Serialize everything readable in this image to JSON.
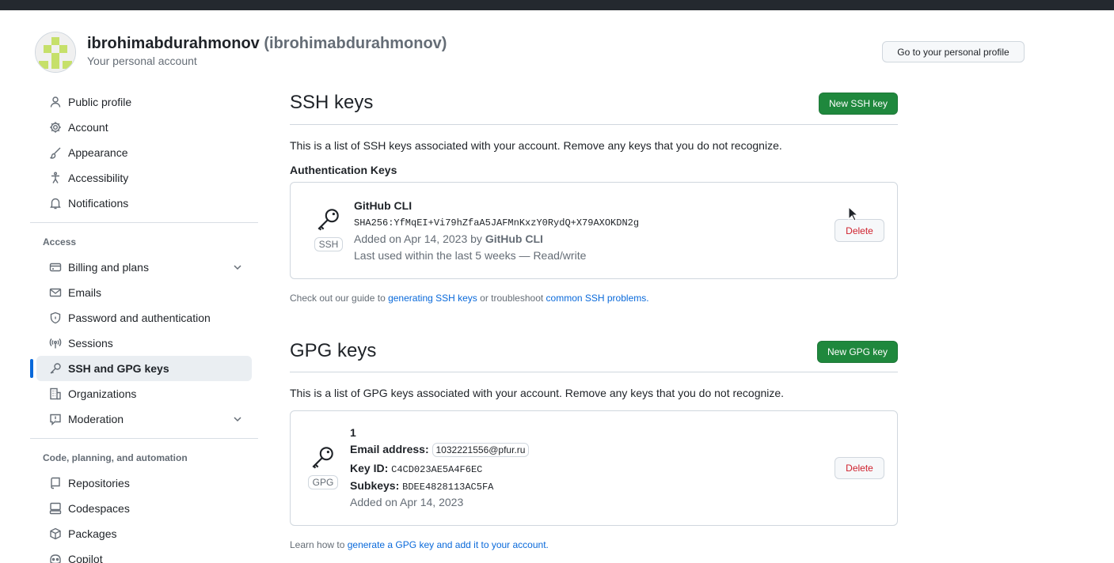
{
  "header": {
    "user_name": "ibrohimabdurahmonov",
    "user_login": "(ibrohimabdurahmonov)",
    "subtitle": "Your personal account",
    "profile_button": "Go to your personal profile",
    "avatar_color": "#c6e06a"
  },
  "sidebar": {
    "items_top": [
      {
        "label": "Public profile",
        "icon": "person-icon"
      },
      {
        "label": "Account",
        "icon": "gear-icon"
      },
      {
        "label": "Appearance",
        "icon": "paintbrush-icon"
      },
      {
        "label": "Accessibility",
        "icon": "accessibility-icon"
      },
      {
        "label": "Notifications",
        "icon": "bell-icon"
      }
    ],
    "access_heading": "Access",
    "items_access": [
      {
        "label": "Billing and plans",
        "icon": "credit-card-icon"
      },
      {
        "label": "Emails",
        "icon": "mail-icon"
      },
      {
        "label": "Password and authentication",
        "icon": "shield-lock-icon"
      },
      {
        "label": "Sessions",
        "icon": "broadcast-icon"
      },
      {
        "label": "SSH and GPG keys",
        "icon": "key-icon"
      },
      {
        "label": "Organizations",
        "icon": "organization-icon"
      },
      {
        "label": "Moderation",
        "icon": "report-icon"
      }
    ],
    "code_heading": "Code, planning, and automation",
    "items_code": [
      {
        "label": "Repositories",
        "icon": "repo-icon"
      },
      {
        "label": "Codespaces",
        "icon": "codespaces-icon"
      },
      {
        "label": "Packages",
        "icon": "package-icon"
      },
      {
        "label": "Copilot",
        "icon": "copilot-icon"
      }
    ]
  },
  "ssh": {
    "title": "SSH keys",
    "new_button": "New SSH key",
    "description": "This is a list of SSH keys associated with your account. Remove any keys that you do not recognize.",
    "auth_heading": "Authentication Keys",
    "key": {
      "name": "GitHub CLI",
      "fingerprint": "SHA256:YfMqEI+Vi79hZfaA5JAFMnKxzY0RydQ+X79AXOKDN2g",
      "added_prefix": "Added on Apr 14, 2023 by ",
      "added_by": "GitHub CLI",
      "last_used": "Last used within the last 5 weeks — Read/write",
      "badge": "SSH",
      "delete_label": "Delete"
    },
    "note_prefix": "Check out our guide to ",
    "note_link1": "generating SSH keys",
    "note_middle": " or troubleshoot ",
    "note_link2": "common SSH problems."
  },
  "gpg": {
    "title": "GPG keys",
    "new_button": "New GPG key",
    "description": "This is a list of GPG keys associated with your account. Remove any keys that you do not recognize.",
    "key": {
      "name": "1",
      "email_label": "Email address:",
      "email": "1032221556@pfur.ru",
      "key_id_label": "Key ID:",
      "key_id": "C4CD023AE5A4F6EC",
      "subkeys_label": "Subkeys:",
      "subkeys": "BDEE4828113AC5FA",
      "added": "Added on Apr 14, 2023",
      "badge": "GPG",
      "delete_label": "Delete"
    },
    "note_prefix": "Learn how to ",
    "note_link": "generate a GPG key and add it to your account."
  }
}
